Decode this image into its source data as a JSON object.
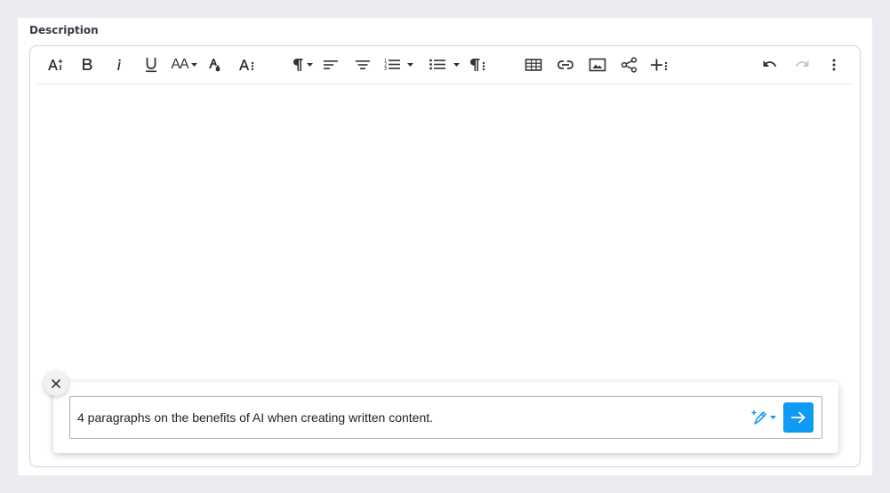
{
  "field": {
    "label": "Description"
  },
  "toolbar": {
    "groups": [
      [
        "ai-assistant-icon",
        "bold-icon",
        "italic-icon",
        "underline-icon",
        "font-size-icon",
        "text-color-icon",
        "more-text-icon"
      ],
      [
        "paragraph-format-icon",
        "align-left-icon",
        "align-center-icon",
        "ordered-list-icon",
        "unordered-list-icon",
        "more-paragraph-icon"
      ],
      [
        "insert-table-icon",
        "insert-link-icon",
        "insert-image-icon",
        "share-icon",
        "more-insert-icon"
      ],
      [
        "undo-icon",
        "redo-icon",
        "more-options-icon"
      ]
    ],
    "labels": {
      "font_size_glyph": "AA"
    }
  },
  "ai_prompt": {
    "value": "4 paragraphs on the benefits of AI when creating written content.",
    "accent_color": "#0f9af5"
  },
  "colors": {
    "page_bg": "#eaebf0",
    "panel_bg": "#ffffff",
    "border": "#cfd3d8",
    "icon": "#333333",
    "icon_disabled": "#c5c8cc"
  }
}
